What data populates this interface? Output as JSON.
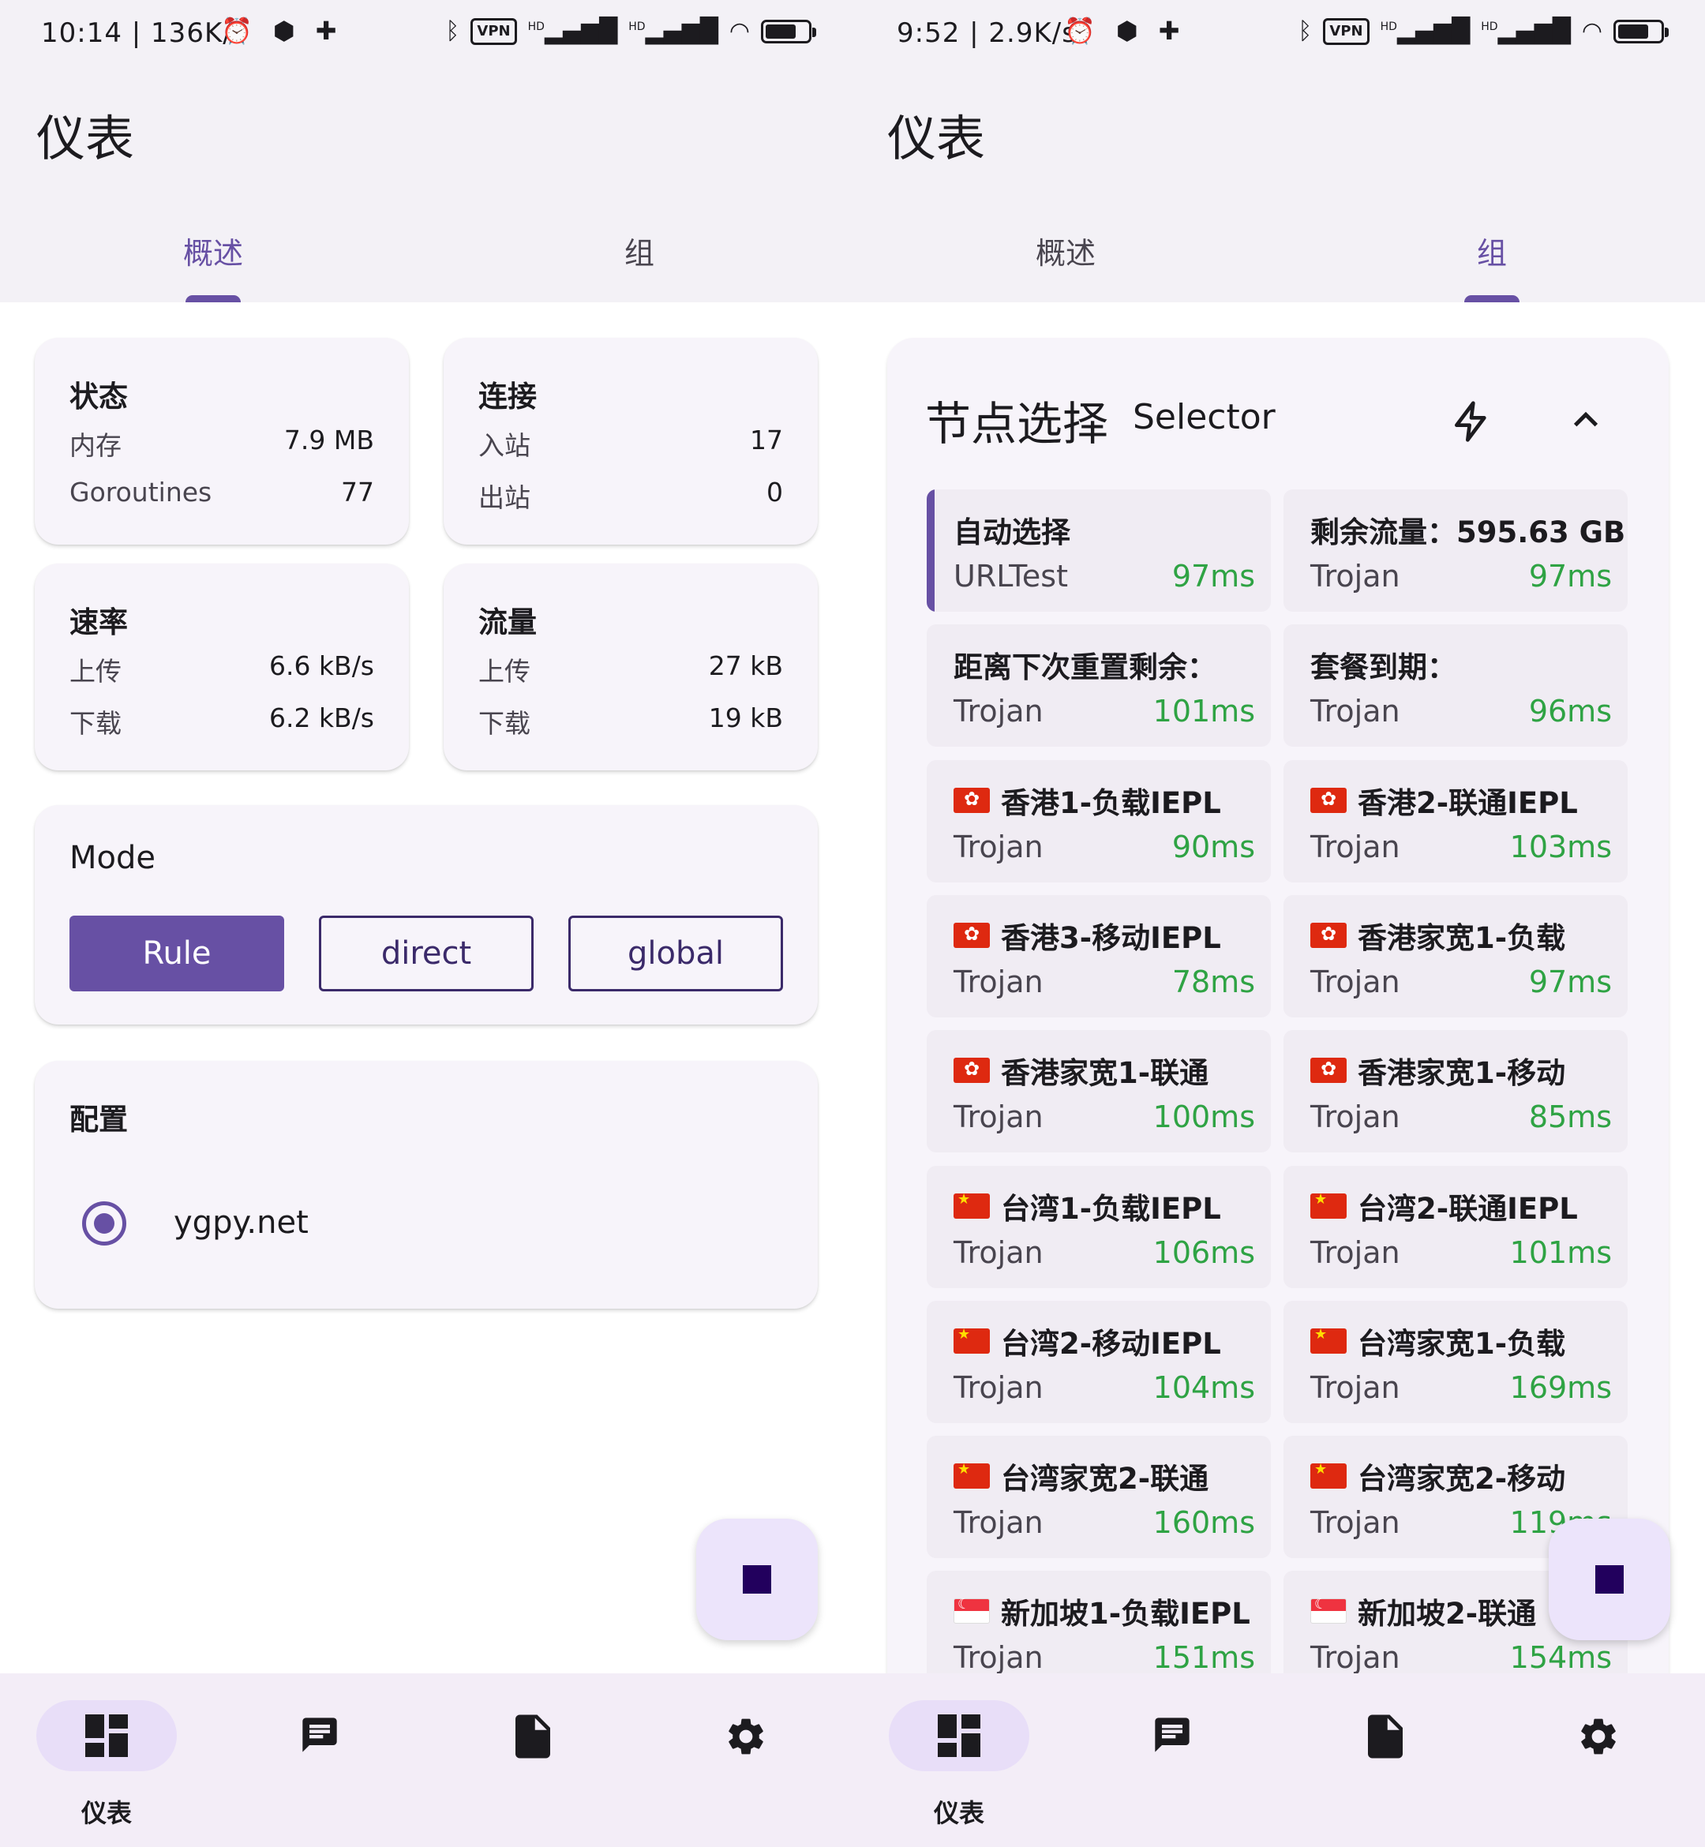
{
  "left": {
    "status": {
      "time": "10:14 | 136K/s",
      "vpn": "VPN",
      "hd1": "HD",
      "hd2": "HD"
    },
    "title": "仪表",
    "tabs": [
      "概述",
      "组"
    ],
    "state_card": {
      "title": "状态",
      "rows": [
        {
          "k": "内存",
          "v": "7.9 MB"
        },
        {
          "k": "Goroutines",
          "v": "77"
        }
      ]
    },
    "conn_card": {
      "title": "连接",
      "rows": [
        {
          "k": "入站",
          "v": "17"
        },
        {
          "k": "出站",
          "v": "0"
        }
      ]
    },
    "rate_card": {
      "title": "速率",
      "rows": [
        {
          "k": "上传",
          "v": "6.6 kB/s"
        },
        {
          "k": "下载",
          "v": "6.2 kB/s"
        }
      ]
    },
    "traffic_card": {
      "title": "流量",
      "rows": [
        {
          "k": "上传",
          "v": "27 kB"
        },
        {
          "k": "下载",
          "v": "19 kB"
        }
      ]
    },
    "mode_card": {
      "title": "Mode",
      "buttons": [
        "Rule",
        "direct",
        "global"
      ],
      "selected": "Rule"
    },
    "config_card": {
      "title": "配置",
      "profile": "ygpy.net"
    }
  },
  "right": {
    "status": {
      "time": "9:52 | 2.9K/s",
      "vpn": "VPN",
      "hd1": "HD",
      "hd2": "HD"
    },
    "title": "仪表",
    "tabs": [
      "概述",
      "组"
    ],
    "group": {
      "name": "节点选择",
      "type": "Selector"
    },
    "proxies": [
      {
        "name": "自动选择",
        "type": "URLTest",
        "delay": "97ms",
        "flag": ""
      },
      {
        "name": "剩余流量：595.63 GB",
        "type": "Trojan",
        "delay": "97ms",
        "flag": ""
      },
      {
        "name": "距离下次重置剩余：",
        "type": "Trojan",
        "delay": "101ms",
        "flag": ""
      },
      {
        "name": "套餐到期：",
        "type": "Trojan",
        "delay": "96ms",
        "flag": ""
      },
      {
        "name": "香港1-负载IEPL",
        "type": "Trojan",
        "delay": "90ms",
        "flag": "hk"
      },
      {
        "name": "香港2-联通IEPL",
        "type": "Trojan",
        "delay": "103ms",
        "flag": "hk"
      },
      {
        "name": "香港3-移动IEPL",
        "type": "Trojan",
        "delay": "78ms",
        "flag": "hk"
      },
      {
        "name": "香港家宽1-负载",
        "type": "Trojan",
        "delay": "97ms",
        "flag": "hk"
      },
      {
        "name": "香港家宽1-联通",
        "type": "Trojan",
        "delay": "100ms",
        "flag": "hk"
      },
      {
        "name": "香港家宽1-移动",
        "type": "Trojan",
        "delay": "85ms",
        "flag": "hk"
      },
      {
        "name": "台湾1-负载IEPL",
        "type": "Trojan",
        "delay": "106ms",
        "flag": "cn"
      },
      {
        "name": "台湾2-联通IEPL",
        "type": "Trojan",
        "delay": "101ms",
        "flag": "cn"
      },
      {
        "name": "台湾2-移动IEPL",
        "type": "Trojan",
        "delay": "104ms",
        "flag": "cn"
      },
      {
        "name": "台湾家宽1-负载",
        "type": "Trojan",
        "delay": "169ms",
        "flag": "cn"
      },
      {
        "name": "台湾家宽2-联通",
        "type": "Trojan",
        "delay": "160ms",
        "flag": "cn"
      },
      {
        "name": "台湾家宽2-移动",
        "type": "Trojan",
        "delay": "119ms",
        "flag": "cn"
      },
      {
        "name": "新加坡1-负载IEPL",
        "type": "Trojan",
        "delay": "151ms",
        "flag": "sg"
      },
      {
        "name": "新加坡2-联通",
        "type": "Trojan",
        "delay": "154ms",
        "flag": "sg"
      }
    ]
  },
  "nav": {
    "items": [
      {
        "icon": "dashboard-icon",
        "label": "仪表"
      },
      {
        "icon": "message-icon",
        "label": ""
      },
      {
        "icon": "file-icon",
        "label": ""
      },
      {
        "icon": "settings-icon",
        "label": ""
      }
    ]
  },
  "colors": {
    "accent": "#6750a4",
    "delay": "#2fa344",
    "surface": "#f7f4fa",
    "fab": "#ece4fb"
  }
}
